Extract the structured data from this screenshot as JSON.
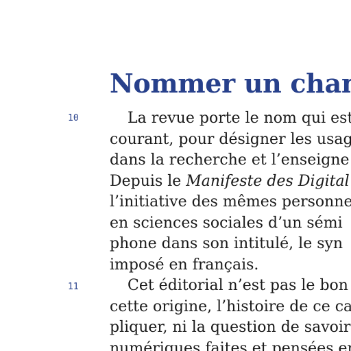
{
  "document": {
    "heading": "Nommer un champ",
    "paragraphs": [
      {
        "number": "10",
        "lines": [
          "La revue porte le nom qui est",
          "courant, pour désigner les usag",
          "dans la recherche et l’enseigne",
          {
            "before": "Depuis le ",
            "italic": "Manifeste des Digital",
            "after": ""
          },
          "l’initiative des mêmes personne",
          "en sciences sociales d’un sémi",
          "phone dans son intitulé, le syn",
          "imposé en français."
        ]
      },
      {
        "number": "11",
        "lines": [
          "Cet éditorial n’est pas le bon",
          "cette origine, l’histoire de ce calc",
          "pliquer, ni la question de savoir",
          "numériques faites et pensées en"
        ]
      }
    ]
  }
}
